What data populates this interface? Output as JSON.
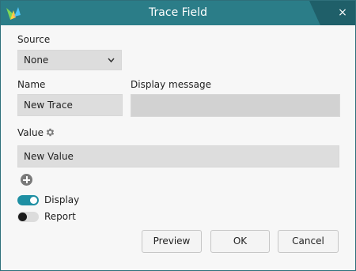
{
  "window": {
    "title": "Trace Field",
    "close_glyph": "×"
  },
  "source": {
    "label": "Source",
    "selected": "None",
    "chevron": "⌄"
  },
  "name": {
    "label": "Name",
    "value": "New Trace"
  },
  "display_message": {
    "label": "Display message",
    "value": ""
  },
  "value": {
    "label": "Value",
    "input_value": "New Value"
  },
  "toggles": {
    "display": {
      "label": "Display",
      "on": true
    },
    "report": {
      "label": "Report",
      "on": false
    }
  },
  "buttons": {
    "preview": "Preview",
    "ok": "OK",
    "cancel": "Cancel"
  },
  "colors": {
    "titlebar": "#2b7d88",
    "titlebar_accent": "#1f5f69",
    "toggle_on": "#1e8fa3"
  },
  "icons": [
    "app-logo-icon",
    "close-icon",
    "chevron-down-icon",
    "gear-icon",
    "add-circle-icon"
  ]
}
